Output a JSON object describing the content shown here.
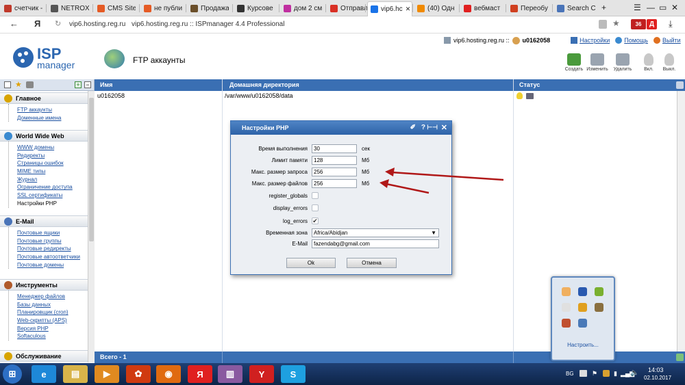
{
  "browser": {
    "tabs": [
      {
        "label": "счетчик -",
        "icon": "counter-tab-icon",
        "color": "#c0392b"
      },
      {
        "label": "NETROX",
        "icon": "netrox-tab-icon",
        "color": "#555555"
      },
      {
        "label": "CMS Site",
        "icon": "cms-tab-icon",
        "color": "#e55b25"
      },
      {
        "label": "не публи",
        "icon": "s-tab-icon",
        "color": "#e55b25"
      },
      {
        "label": "Продажа",
        "icon": "house-tab-icon",
        "color": "#6b4f2a"
      },
      {
        "label": "Курсове",
        "icon": "t-tab-icon",
        "color": "#333333"
      },
      {
        "label": "дом 2 см",
        "icon": "two-tab-icon",
        "color": "#c02fa0"
      },
      {
        "label": "Отправл",
        "icon": "gmail-tab-icon",
        "color": "#d93025"
      },
      {
        "label": "vip6.hc",
        "icon": "check-tab-icon",
        "color": "#1a73e8",
        "active": true
      },
      {
        "label": "(40) Одн",
        "icon": "ok-tab-icon",
        "color": "#f08a00"
      },
      {
        "label": "вебмаст",
        "icon": "yandex-tab-icon",
        "color": "#e02020"
      },
      {
        "label": "Переобу",
        "icon": "arrows-tab-icon",
        "color": "#d04020"
      },
      {
        "label": "Search Co",
        "icon": "search-console-tab-icon",
        "color": "#4a74b8"
      }
    ],
    "new_tab": "+",
    "win_controls": [
      "☰",
      "—",
      "▭",
      "✕",
      "⤓"
    ],
    "nav_back": "←",
    "y_logo": "Я",
    "reload": "↻",
    "address_domain": "vip6.hosting.reg.ru",
    "address_title": "vip6.hosting.reg.ru :: ISPmanager 4.4 Professional",
    "badge_count": "36",
    "badge_letter": "Д"
  },
  "header": {
    "server": "vip6.hosting.reg.ru ::",
    "user": "u0162058",
    "settings_link": "Настройки",
    "help_link": "Помощь",
    "logout_link": "Выйти",
    "logo_big": "ISP",
    "logo_small": "manager",
    "page_title": "FTP аккаунты",
    "toolbar": [
      {
        "label": "Создать",
        "icon": "create-icon",
        "color": "#4a9a3c"
      },
      {
        "label": "Изменить",
        "icon": "edit-icon",
        "color": "#9aa4b0"
      },
      {
        "label": "Удалить",
        "icon": "delete-icon",
        "color": "#9aa4b0"
      },
      {
        "label": "Вкл.",
        "icon": "enable-bulb-icon",
        "color": "#c8c8c8"
      },
      {
        "label": "Выкл.",
        "icon": "disable-bulb-icon",
        "color": "#c8c8c8"
      }
    ]
  },
  "sidebar": {
    "sections": [
      {
        "title": "Главное",
        "color": "#d8a400",
        "items": [
          {
            "label": "FTP аккаунты",
            "link": true
          },
          {
            "label": "Доменные имена",
            "link": true
          }
        ]
      },
      {
        "title": "World Wide Web",
        "color": "#3a8ad0",
        "items": [
          {
            "label": "WWW домены",
            "link": true
          },
          {
            "label": "Редиректы",
            "link": true
          },
          {
            "label": "Страницы ошибок",
            "link": true
          },
          {
            "label": "MIME типы",
            "link": true
          },
          {
            "label": "Журнал",
            "link": true
          },
          {
            "label": "Ограничение доступа",
            "link": true
          },
          {
            "label": "SSL сертификаты",
            "link": true
          },
          {
            "label": "Настройки PHP",
            "link": false
          }
        ]
      },
      {
        "title": "E-Mail",
        "color": "#4a74b8",
        "items": [
          {
            "label": "Почтовые ящики",
            "link": true
          },
          {
            "label": "Почтовые группы",
            "link": true
          },
          {
            "label": "Почтовые редиректы",
            "link": true
          },
          {
            "label": "Почтовые автоответчики",
            "link": true
          },
          {
            "label": "Почтовые домены",
            "link": true
          }
        ]
      },
      {
        "title": "Инструменты",
        "color": "#b05a2a",
        "items": [
          {
            "label": "Менеджер файлов",
            "link": true
          },
          {
            "label": "Базы данных",
            "link": true
          },
          {
            "label": "Планировщик (cron)",
            "link": true
          },
          {
            "label": "Web-скрипты (APS)",
            "link": true
          },
          {
            "label": "Версия PHP",
            "link": true
          },
          {
            "label": "Softaculous",
            "link": true
          }
        ]
      },
      {
        "title": "Обслуживание",
        "color": "#d8a400",
        "items": []
      }
    ]
  },
  "grid": {
    "columns": [
      "Имя",
      "Домашняя директория",
      "Статус"
    ],
    "rows": [
      {
        "name": "u0162058",
        "home": "/var/www/u0162058/data"
      }
    ],
    "footer": "Всего - 1"
  },
  "dialog": {
    "title": "Настройки PHP",
    "title_icons": [
      "✐",
      "?",
      "⊢⊣",
      "✕"
    ],
    "fields": [
      {
        "label": "Время выполнения",
        "value": "30",
        "unit": "сек"
      },
      {
        "label": "Лимит памяти",
        "value": "128",
        "unit": "Мб"
      },
      {
        "label": "Макс. размер запроса",
        "value": "256",
        "unit": "Мб"
      },
      {
        "label": "Макс. размер файлов",
        "value": "256",
        "unit": "Мб"
      }
    ],
    "checks": [
      {
        "label": "register_globals",
        "checked": false
      },
      {
        "label": "display_errors",
        "checked": false
      },
      {
        "label": "log_errors",
        "checked": true
      }
    ],
    "timezone_label": "Временная зона",
    "timezone_value": "Africa/Abidjan",
    "email_label": "E-Mail",
    "email_value": "fazendabg@gmail.com",
    "ok_label": "Ok",
    "cancel_label": "Отмена"
  },
  "tray_popup": {
    "customize": "Настроить...",
    "icons": [
      "tray-app-icon",
      "bluetooth-icon",
      "evernote-icon",
      "flag-icon",
      "antivirus-icon",
      "tool-icon",
      "multicolor-icon",
      "network-icon"
    ]
  },
  "taskbar": {
    "apps": [
      {
        "name": "start-button-icon",
        "glyph": "⊞",
        "color": "#2d6fc4"
      },
      {
        "name": "ie-icon",
        "glyph": "e",
        "color": "#1e88d8"
      },
      {
        "name": "explorer-icon",
        "glyph": "▤",
        "color": "#d8b44a"
      },
      {
        "name": "media-player-icon",
        "glyph": "▶",
        "color": "#e08a20"
      },
      {
        "name": "reel-icon",
        "glyph": "✿",
        "color": "#d03a10"
      },
      {
        "name": "firefox-icon",
        "glyph": "◉",
        "color": "#e06a10"
      },
      {
        "name": "yandex-icon",
        "glyph": "Я",
        "color": "#e02020"
      },
      {
        "name": "winrar-icon",
        "glyph": "▥",
        "color": "#8a5aa0"
      },
      {
        "name": "yandex-browser-icon",
        "glyph": "Y",
        "color": "#d02020"
      },
      {
        "name": "skype-icon",
        "glyph": "S",
        "color": "#1ea0e0"
      }
    ],
    "lang": "BG",
    "time": "14:03",
    "date": "02.10.2017"
  }
}
